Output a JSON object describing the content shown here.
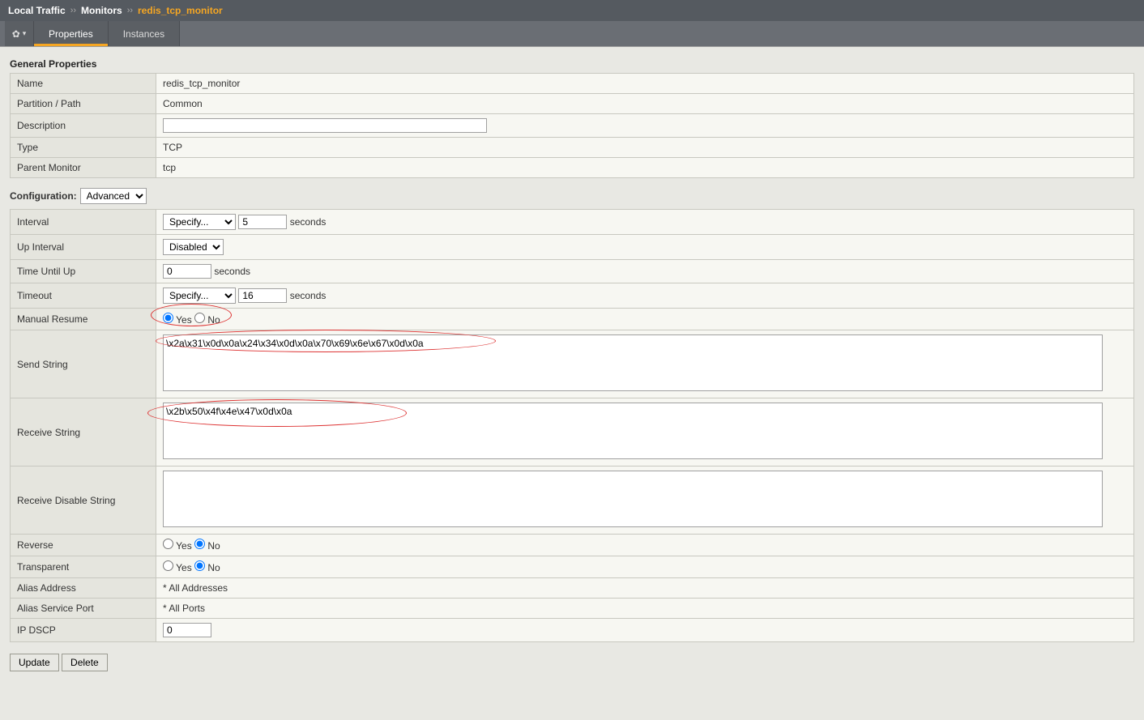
{
  "breadcrumb": {
    "level1": "Local Traffic",
    "level2": "Monitors",
    "level3": "redis_tcp_monitor",
    "sep": "››"
  },
  "tabs": {
    "properties": "Properties",
    "instances": "Instances"
  },
  "sections": {
    "general_title": "General Properties",
    "config_label": "Configuration:",
    "config_select": "Advanced"
  },
  "general": {
    "name_lbl": "Name",
    "name_val": "redis_tcp_monitor",
    "partition_lbl": "Partition / Path",
    "partition_val": "Common",
    "description_lbl": "Description",
    "description_val": "",
    "type_lbl": "Type",
    "type_val": "TCP",
    "parent_lbl": "Parent Monitor",
    "parent_val": "tcp"
  },
  "config": {
    "interval_lbl": "Interval",
    "interval_mode": "Specify...",
    "interval_val": "5",
    "seconds": "seconds",
    "upinterval_lbl": "Up Interval",
    "upinterval_mode": "Disabled",
    "timeuntilup_lbl": "Time Until Up",
    "timeuntilup_val": "0",
    "timeout_lbl": "Timeout",
    "timeout_mode": "Specify...",
    "timeout_val": "16",
    "manualresume_lbl": "Manual Resume",
    "yes": "Yes",
    "no": "No",
    "sendstr_lbl": "Send String",
    "sendstr_val": "\\x2a\\x31\\x0d\\x0a\\x24\\x34\\x0d\\x0a\\x70\\x69\\x6e\\x67\\x0d\\x0a",
    "recvstr_lbl": "Receive String",
    "recvstr_val": "\\x2b\\x50\\x4f\\x4e\\x47\\x0d\\x0a",
    "recvdis_lbl": "Receive Disable String",
    "recvdis_val": "",
    "reverse_lbl": "Reverse",
    "transparent_lbl": "Transparent",
    "aliasaddr_lbl": "Alias Address",
    "aliasaddr_val": "* All Addresses",
    "aliasport_lbl": "Alias Service Port",
    "aliasport_val": "* All Ports",
    "ipdscp_lbl": "IP DSCP",
    "ipdscp_val": "0"
  },
  "buttons": {
    "update": "Update",
    "delete": "Delete"
  },
  "annotations": {
    "ellipse1": "red ellipse around Manual Resume Yes/No",
    "ellipse2": "red ellipse around Send String value",
    "ellipse3": "red ellipse around first part of Receive String value"
  }
}
